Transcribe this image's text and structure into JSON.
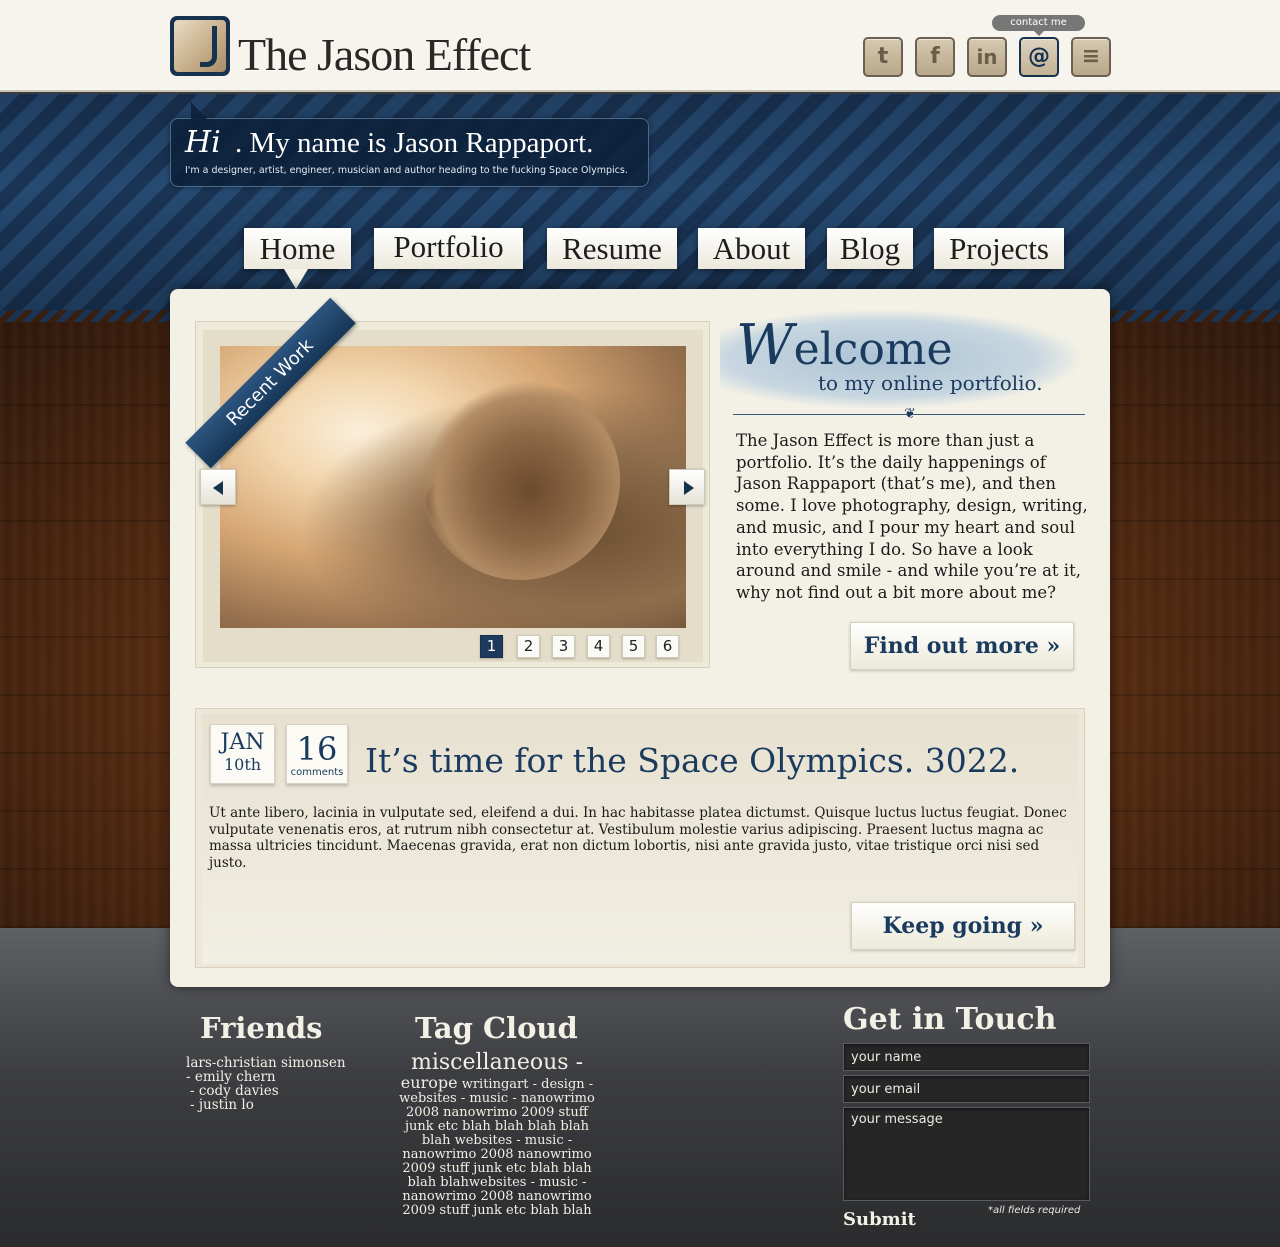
{
  "header": {
    "site_title": "The Jason Effect",
    "contact_tooltip": "contact me",
    "social_icons": [
      {
        "name": "twitter-icon",
        "glyph": "t"
      },
      {
        "name": "facebook-icon",
        "glyph": "f"
      },
      {
        "name": "linkedin-icon",
        "glyph": "in"
      },
      {
        "name": "email-icon",
        "glyph": "@"
      },
      {
        "name": "rss-icon",
        "glyph": "≡"
      }
    ]
  },
  "intro": {
    "hi": "Hi",
    "title": ". My name is Jason Rappaport.",
    "subtitle": "I'm a designer, artist, engineer, musician and author heading to the fucking Space Olympics."
  },
  "nav": {
    "items": [
      "Home",
      "Portfolio",
      "Resume",
      "About",
      "Blog",
      "Projects"
    ],
    "active": "Home"
  },
  "slider": {
    "ribbon": "Recent Work",
    "pages": [
      "1",
      "2",
      "3",
      "4",
      "5",
      "6"
    ],
    "active_page": "1"
  },
  "welcome": {
    "title_initial": "W",
    "title_rest": "elcome",
    "subtitle": "to my online portfolio.",
    "body": "The Jason Effect is more than just a portfolio. It’s the daily happenings of Jason Rappaport (that’s me), and then some. I love photography, design, writing, and music, and I pour my heart and soul into everything I do. So have a look around and smile - and while you’re at it, why not find out a bit more about me?",
    "button": "Find out more »"
  },
  "post": {
    "month": "JAN",
    "day": "10th",
    "comment_count": "16",
    "comment_label": "comments",
    "title": "It’s time for the Space Olympics. 3022.",
    "body": "Ut ante libero, lacinia in vulputate sed, eleifend a dui. In hac habitasse platea dictumst. Quisque luctus luctus feugiat. Donec vulputate venenatis eros, at rutrum nibh consectetur at. Vestibulum molestie varius adipiscing. Praesent luctus magna ac massa ultricies tincidunt. Maecenas gravida, erat non dictum lobortis, nisi ante gravida justo, vitae tristique orci nisi sed justo.",
    "button": "Keep going »"
  },
  "footer": {
    "friends_title": "Friends",
    "friends": [
      "lars-christian simonsen",
      "- emily chern",
      "- cody davies",
      "- justin lo"
    ],
    "tags_title": "Tag Cloud",
    "tags_big": "miscellaneous -",
    "tags_medium": "europe",
    "tags_rest": "writingart - design - websites -  music - nanowrimo 2008 nanowrimo 2009 stuff junk etc blah blah blah blah blah websites -  music - nanowrimo 2008 nanowrimo 2009 stuff junk etc blah blah blah blahwebsites -  music - nanowrimo 2008 nanowrimo 2009 stuff junk etc blah blah",
    "contact_title": "Get in Touch",
    "name_placeholder": "your name",
    "email_placeholder": "your email",
    "message_placeholder": "your message",
    "submit": "Submit",
    "required_note": "*all fields required"
  }
}
